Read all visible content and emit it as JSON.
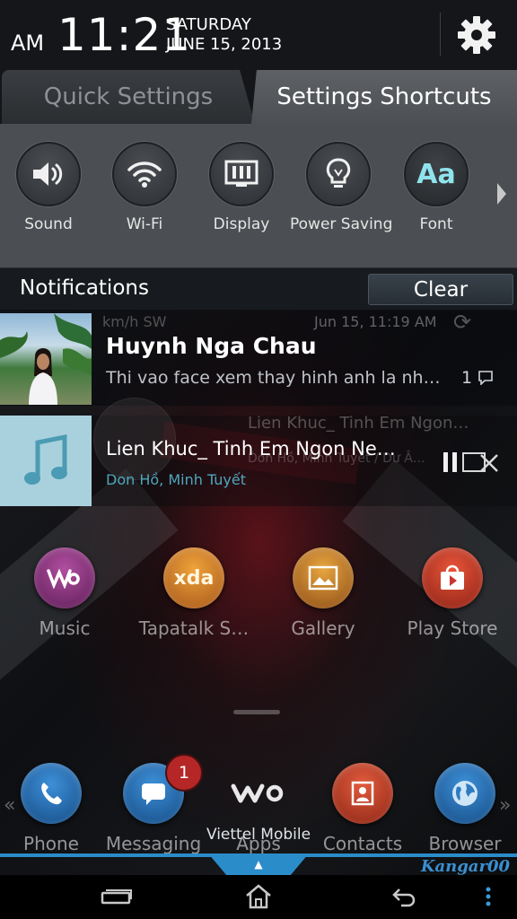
{
  "status": {
    "ampm": "AM",
    "time": "11:21",
    "day": "SATURDAY",
    "date": "JUNE 15, 2013"
  },
  "tabs": {
    "quick": "Quick Settings",
    "shortcuts": "Settings Shortcuts"
  },
  "shortcuts": [
    {
      "label": "Sound",
      "icon": "speaker-icon"
    },
    {
      "label": "Wi-Fi",
      "icon": "wifi-icon"
    },
    {
      "label": "Display",
      "icon": "display-icon"
    },
    {
      "label": "Power Saving",
      "icon": "lightbulb-icon"
    },
    {
      "label": "Font",
      "icon": "font-icon",
      "glyph": "Aa"
    }
  ],
  "notifications": {
    "title": "Notifications",
    "clear": "Clear",
    "items": [
      {
        "name": "Huynh Nga Chau",
        "message": "Thi vao face xem thay hinh anh la nh…",
        "count": "1",
        "ghost_left": "km/h SW",
        "ghost_time": "Jun 15, 11:19 AM"
      },
      {
        "title": "Lien Khuc_ Tinh Em Ngon Ne…",
        "artist": "Don Hồ, Minh Tuyết",
        "ghost_title": "Lien Khuc_ Tinh Em Ngon…",
        "ghost_artist": "Don Hồ, Minh Tuyết / Dư Â…"
      }
    ]
  },
  "home": {
    "apps_row1": [
      "Music",
      "Tapatalk S…",
      "Gallery",
      "Play Store"
    ],
    "dock": [
      "Phone",
      "Messaging",
      "Apps",
      "Contacts",
      "Browser"
    ],
    "messaging_badge": "1",
    "xda_text": "xda",
    "carrier": "Viettel Mobile",
    "watermark": "Kangar00"
  },
  "colors": {
    "accent_blue": "#2a8cc9",
    "font_icon": "#8fe3ec",
    "artist_text": "#4ea7bd",
    "badge": "#b52727"
  }
}
